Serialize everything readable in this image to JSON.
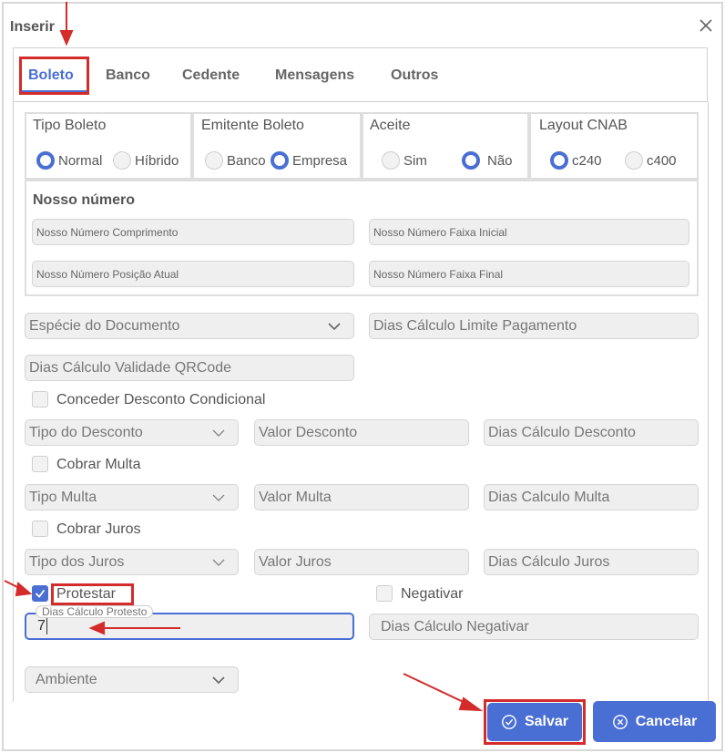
{
  "dialog": {
    "title": "Inserir",
    "close_icon": "close-icon"
  },
  "tabs": [
    "Boleto",
    "Banco",
    "Cedente",
    "Mensagens",
    "Outros"
  ],
  "tipo_boleto": {
    "label": "Tipo Boleto",
    "options": [
      "Normal",
      "Híbrido"
    ],
    "selected": "Normal"
  },
  "emitente_boleto": {
    "label": "Emitente Boleto",
    "options": [
      "Banco",
      "Empresa"
    ],
    "selected": "Empresa"
  },
  "aceite": {
    "label": "Aceite",
    "options": [
      "Sim",
      "Não"
    ],
    "selected": "Não"
  },
  "layout_cnab": {
    "label": "Layout CNAB",
    "options": [
      "c240",
      "c400"
    ],
    "selected": "c240"
  },
  "nosso_numero": {
    "title": "Nosso número",
    "comprimento": "Nosso Número Comprimento",
    "faixa_inicial": "Nosso Número Faixa Inicial",
    "posicao_atual": "Nosso Número Posição Atual",
    "faixa_final": "Nosso Número Faixa Final"
  },
  "especie_documento": "Espécie do Documento",
  "dias_limite_pagamento": "Dias Cálculo Limite Pagamento",
  "dias_validade_qrcode": "Dias Cálculo Validade QRCode",
  "desconto": {
    "checkbox": "Conceder Desconto Condicional",
    "checked": false,
    "tipo": "Tipo do Desconto",
    "valor": "Valor Desconto",
    "dias": "Dias Cálculo Desconto"
  },
  "multa": {
    "checkbox": "Cobrar Multa",
    "checked": false,
    "tipo": "Tipo Multa",
    "valor": "Valor Multa",
    "dias": "Dias Calculo Multa"
  },
  "juros": {
    "checkbox": "Cobrar Juros",
    "checked": false,
    "tipo": "Tipo dos Juros",
    "valor": "Valor Juros",
    "dias": "Dias Cálculo Juros"
  },
  "protestar": {
    "checkbox": "Protestar",
    "checked": true,
    "field_label": "Dias Cálculo Protesto",
    "value": "7"
  },
  "negativar": {
    "checkbox": "Negativar",
    "checked": false,
    "field": "Dias Cálculo Negativar"
  },
  "ambiente": "Ambiente",
  "buttons": {
    "save": "Salvar",
    "cancel": "Cancelar"
  },
  "colors": {
    "accent": "#4a6fd4",
    "annotation": "#d42b2b"
  }
}
